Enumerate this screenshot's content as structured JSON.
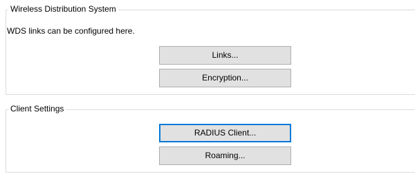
{
  "wds": {
    "title": "Wireless Distribution System",
    "description": "WDS links can be configured here.",
    "links_label": "Links...",
    "encryption_label": "Encryption..."
  },
  "client_settings": {
    "title": "Client Settings",
    "radius_client_label": "RADIUS Client...",
    "roaming_label": "Roaming..."
  },
  "colors": {
    "button_face": "#e1e1e1",
    "button_border": "#adadad",
    "focus_border": "#0078d7",
    "group_border": "#dcdcdc"
  }
}
